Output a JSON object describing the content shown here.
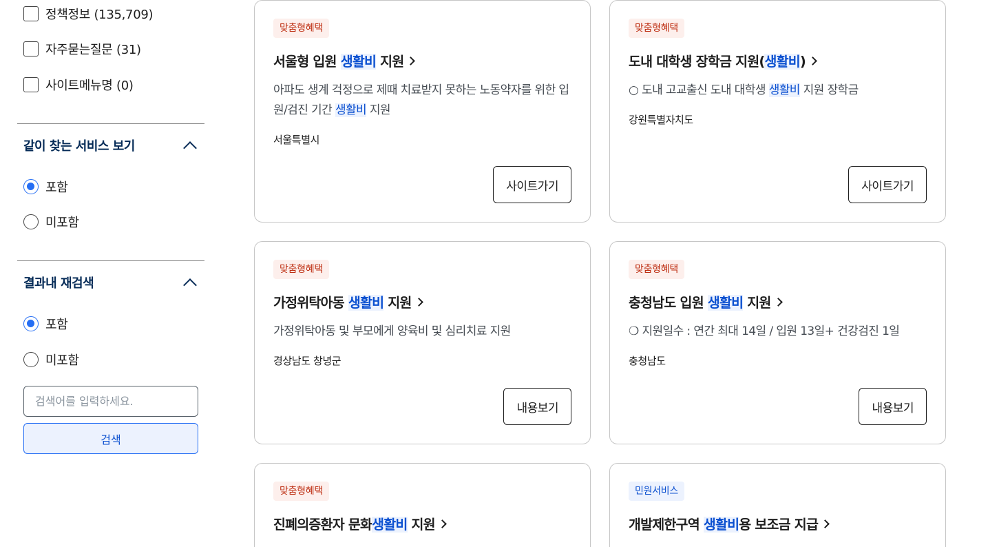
{
  "filters": {
    "categories": [
      {
        "label": "정책정보 (135,709)"
      },
      {
        "label": "자주묻는질문 (31)"
      },
      {
        "label": "사이트메뉴명 (0)"
      }
    ],
    "related_services": {
      "title": "같이 찾는 서비스 보기",
      "options": [
        "포함",
        "미포함"
      ],
      "selected": "포함"
    },
    "research": {
      "title": "결과내 재검색",
      "options": [
        "포함",
        "미포함"
      ],
      "selected": "포함",
      "input_placeholder": "검색어를 입력하세요.",
      "search_label": "검색"
    }
  },
  "highlight_color": "#0b50d0",
  "cards": [
    {
      "tag": "맞춤형혜택",
      "tag_type": "custom",
      "title_pre": "서울형 입원 ",
      "title_hl": "생활비",
      "title_post": " 지원",
      "desc_pre": "아파도 생계 걱정으로 제때 치료받지 못하는 노동약자를 위한 입원/검진 기간 ",
      "desc_hl": "생활비",
      "desc_post": " 지원",
      "region": "서울특별시",
      "button": "사이트가기"
    },
    {
      "tag": "맞춤형혜택",
      "tag_type": "custom",
      "title_pre": "도내 대학생 장학금 지원(",
      "title_hl": "생활비",
      "title_post": ")",
      "desc_pre": "○ 도내 고교출신 도내 대학생 ",
      "desc_hl": "생활비",
      "desc_post": " 지원 장학금",
      "region": "강원특별자치도",
      "button": "사이트가기"
    },
    {
      "tag": "맞춤형혜택",
      "tag_type": "custom",
      "title_pre": "가정위탁아동 ",
      "title_hl": "생활비",
      "title_post": " 지원",
      "desc_pre": "가정위탁아동 및 부모에게 양육비 및 심리치료 지원",
      "desc_hl": "",
      "desc_post": "",
      "region": "경상남도 창녕군",
      "button": "내용보기"
    },
    {
      "tag": "맞춤형혜택",
      "tag_type": "custom",
      "title_pre": "충청남도 입원 ",
      "title_hl": "생활비",
      "title_post": " 지원",
      "desc_pre": "❍ 지원일수 : 연간 최대 14일 / 입원 13일+ 건강검진 1일",
      "desc_hl": "",
      "desc_post": "",
      "region": "충청남도",
      "button": "내용보기"
    },
    {
      "tag": "맞춤형혜택",
      "tag_type": "custom",
      "title_pre": "진폐의증환자 문화",
      "title_hl": "생활비",
      "title_post": " 지원"
    },
    {
      "tag": "민원서비스",
      "tag_type": "civil",
      "title_pre": "개발제한구역 ",
      "title_hl": "생활비",
      "title_post": "용 보조금 지급"
    }
  ]
}
